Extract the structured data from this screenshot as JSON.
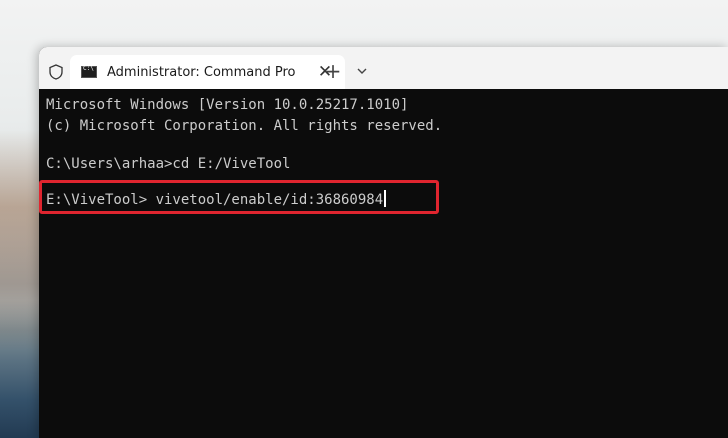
{
  "window": {
    "tab_title": "Administrator: Command Pro",
    "tab_close": "✕",
    "new_tab": "+"
  },
  "console": {
    "lines": [
      "Microsoft Windows [Version 10.0.25217.1010]",
      "(c) Microsoft Corporation. All rights reserved.",
      "",
      "C:\\Users\\arhaa>cd E:/ViveTool"
    ],
    "prompt_line": "E:\\ViveTool> vivetool/enable/id:36860984"
  },
  "colors": {
    "highlight": "#e0252f",
    "console_bg": "#0c0c0c",
    "console_text": "#cccccc"
  },
  "icons": {
    "shield": "shield-icon",
    "tab": "cmd-icon",
    "dropdown": "chevron-down-icon"
  }
}
